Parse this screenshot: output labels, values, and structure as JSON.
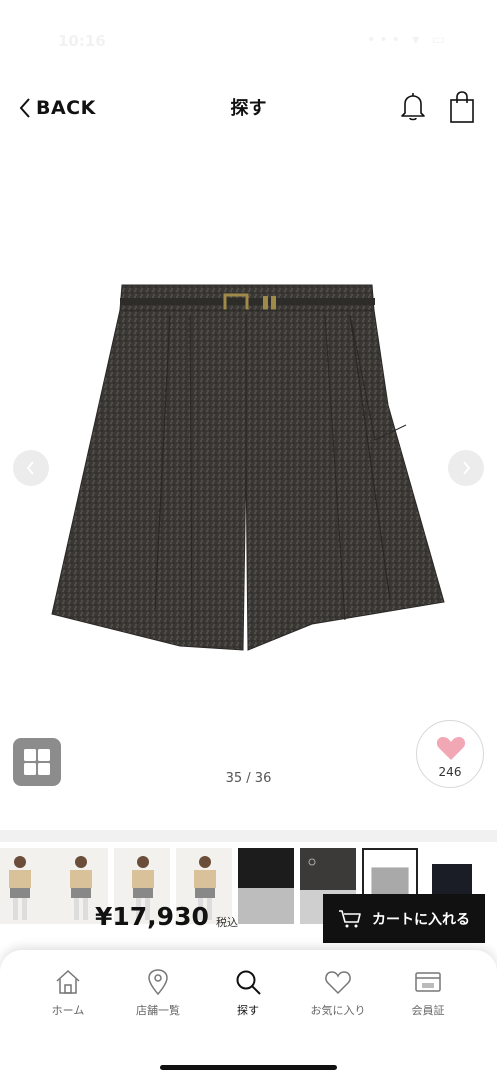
{
  "status_bar": {
    "time": "10:16",
    "icons": "••• ▾ ▭"
  },
  "header": {
    "back_label": "BACK",
    "title": "探す"
  },
  "product": {
    "image_desc": "tweed-shorts",
    "page_counter": "35 / 36",
    "like_count": "246",
    "price": "¥17,930",
    "tax_label": "税込",
    "cart_button": "カートに入れる"
  },
  "thumbnails": [
    "look-1",
    "look-2",
    "look-3",
    "look-4",
    "black-shorts",
    "grey-shorts",
    "light-grey-shorts",
    "navy-shorts"
  ],
  "tabs": [
    {
      "label": "ホーム",
      "icon": "home-icon"
    },
    {
      "label": "店舗一覧",
      "icon": "location-pin-icon"
    },
    {
      "label": "探す",
      "icon": "search-icon",
      "active": true
    },
    {
      "label": "お気に入り",
      "icon": "heart-icon"
    },
    {
      "label": "会員証",
      "icon": "member-card-icon"
    }
  ],
  "colors": {
    "accent_heart": "#f2a7b5",
    "cart_button": "#111111",
    "grid_button": "#8c8c8c"
  }
}
